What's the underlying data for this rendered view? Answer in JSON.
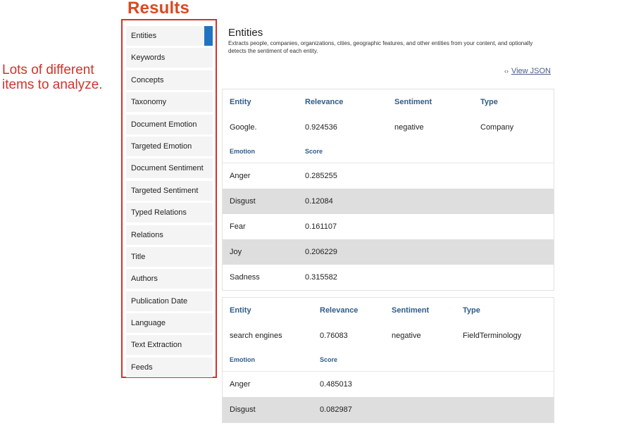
{
  "heading": "Results",
  "annotation": {
    "line1": "Lots of different",
    "line2": "items to analyze."
  },
  "sidebar": {
    "items": [
      {
        "label": "Entities"
      },
      {
        "label": "Keywords"
      },
      {
        "label": "Concepts"
      },
      {
        "label": "Taxonomy"
      },
      {
        "label": "Document Emotion"
      },
      {
        "label": "Targeted Emotion"
      },
      {
        "label": "Document Sentiment"
      },
      {
        "label": "Targeted Sentiment"
      },
      {
        "label": "Typed Relations"
      },
      {
        "label": "Relations"
      },
      {
        "label": "Title"
      },
      {
        "label": "Authors"
      },
      {
        "label": "Publication Date"
      },
      {
        "label": "Language"
      },
      {
        "label": "Text Extraction"
      },
      {
        "label": "Feeds"
      }
    ],
    "active_index": 0
  },
  "main": {
    "title": "Entities",
    "description": "Extracts people, companies, organizations, cities, geographic features, and other entities from your content, and optionally detects the sentiment of each entity.",
    "view_json_label": "View JSON",
    "view_json_icon": "code-icon",
    "entities": [
      {
        "headers": {
          "entity": "Entity",
          "relevance": "Relevance",
          "sentiment": "Sentiment",
          "type": "Type"
        },
        "entity": "Google.",
        "relevance": "0.924536",
        "sentiment": "negative",
        "type": "Company",
        "emotion_headers": {
          "emotion": "Emotion",
          "score": "Score"
        },
        "emotions": [
          {
            "name": "Anger",
            "score": "0.285255"
          },
          {
            "name": "Disgust",
            "score": "0.12084"
          },
          {
            "name": "Fear",
            "score": "0.161107"
          },
          {
            "name": "Joy",
            "score": "0.206229"
          },
          {
            "name": "Sadness",
            "score": "0.315582"
          }
        ]
      },
      {
        "headers": {
          "entity": "Entity",
          "relevance": "Relevance",
          "sentiment": "Sentiment",
          "type": "Type"
        },
        "entity": "search engines",
        "relevance": "0.76083",
        "sentiment": "negative",
        "type": "FieldTerminology",
        "emotion_headers": {
          "emotion": "Emotion",
          "score": "Score"
        },
        "emotions": [
          {
            "name": "Anger",
            "score": "0.485013"
          },
          {
            "name": "Disgust",
            "score": "0.082987"
          }
        ]
      }
    ]
  },
  "colors": {
    "accent": "#1f74c1",
    "highlight": "#d0342c",
    "heading": "#d94a1e"
  }
}
